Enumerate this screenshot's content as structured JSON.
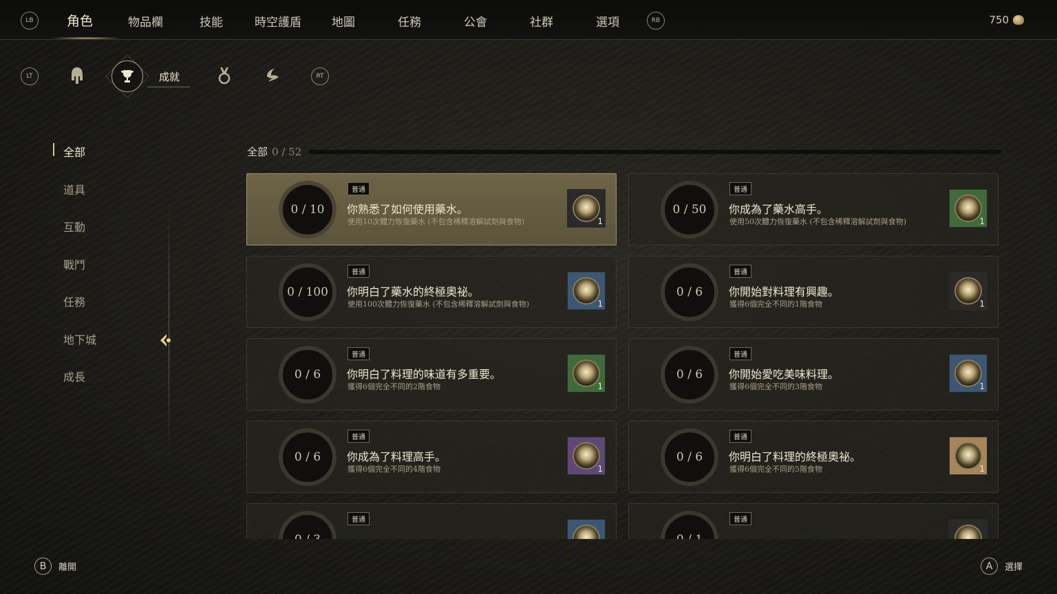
{
  "nav": {
    "left_bumper": "LB",
    "right_bumper": "RB",
    "items": [
      "角色",
      "物品欄",
      "技能",
      "時空護盾",
      "地圖",
      "任務",
      "公會",
      "社群",
      "選項"
    ],
    "active_index": 0,
    "currency_value": "750"
  },
  "subtabs": {
    "left_trigger": "LT",
    "right_trigger": "RT",
    "icons": [
      "helmet-icon",
      "trophy-icon",
      "medal-icon",
      "laurel-icon"
    ],
    "active_label": "成就"
  },
  "categories": {
    "items": [
      "全部",
      "道具",
      "互動",
      "戰鬥",
      "任務",
      "地下城",
      "成長"
    ],
    "active_index": 0
  },
  "list": {
    "header_label": "全部",
    "header_count": "0 / 52"
  },
  "achievements": [
    {
      "progress": "0 / 10",
      "tier": "普通",
      "title": "你熟悉了如何使用藥水。",
      "desc": "使用10次體力恢復藥水 (不包含稀釋溶解試劑與食物)",
      "reward_qty": "1",
      "reward_bg": "#2a2a2a",
      "selected": true
    },
    {
      "progress": "0 / 50",
      "tier": "普通",
      "title": "你成為了藥水高手。",
      "desc": "使用50次體力恢復藥水 (不包含稀釋溶解試劑與食物)",
      "reward_qty": "1",
      "reward_bg": "#3f6b3a",
      "selected": false
    },
    {
      "progress": "0 / 100",
      "tier": "普通",
      "title": "你明白了藥水的終極奧祕。",
      "desc": "使用100次體力恢復藥水 (不包含稀釋溶解試劑與食物)",
      "reward_qty": "1",
      "reward_bg": "#3c5676",
      "selected": false
    },
    {
      "progress": "0 / 6",
      "tier": "普通",
      "title": "你開始對料理有興趣。",
      "desc": "獲得6個完全不同的1階食物",
      "reward_qty": "1",
      "reward_bg": "#2a2a2a",
      "selected": false
    },
    {
      "progress": "0 / 6",
      "tier": "普通",
      "title": "你明白了料理的味道有多重要。",
      "desc": "獲得6個完全不同的2階食物",
      "reward_qty": "1",
      "reward_bg": "#3f6b3a",
      "selected": false
    },
    {
      "progress": "0 / 6",
      "tier": "普通",
      "title": "你開始愛吃美味料理。",
      "desc": "獲得6個完全不同的3階食物",
      "reward_qty": "1",
      "reward_bg": "#3c5676",
      "selected": false
    },
    {
      "progress": "0 / 6",
      "tier": "普通",
      "title": "你成為了料理高手。",
      "desc": "獲得6個完全不同的4階食物",
      "reward_qty": "1",
      "reward_bg": "#5e4877",
      "selected": false
    },
    {
      "progress": "0 / 6",
      "tier": "普通",
      "title": "你明白了料理的終極奧祕。",
      "desc": "獲得6個完全不同的5階食物",
      "reward_qty": "1",
      "reward_bg": "#a6855a",
      "selected": false
    },
    {
      "progress": "0 / 3",
      "tier": "普通",
      "title": "",
      "desc": "",
      "reward_qty": "",
      "reward_bg": "#3c5676",
      "selected": false
    },
    {
      "progress": "0 / 1",
      "tier": "普通",
      "title": "",
      "desc": "",
      "reward_qty": "",
      "reward_bg": "#2a2a2a",
      "selected": false
    }
  ],
  "footer": {
    "back_key": "B",
    "back_label": "離開",
    "select_key": "A",
    "select_label": "選擇"
  }
}
